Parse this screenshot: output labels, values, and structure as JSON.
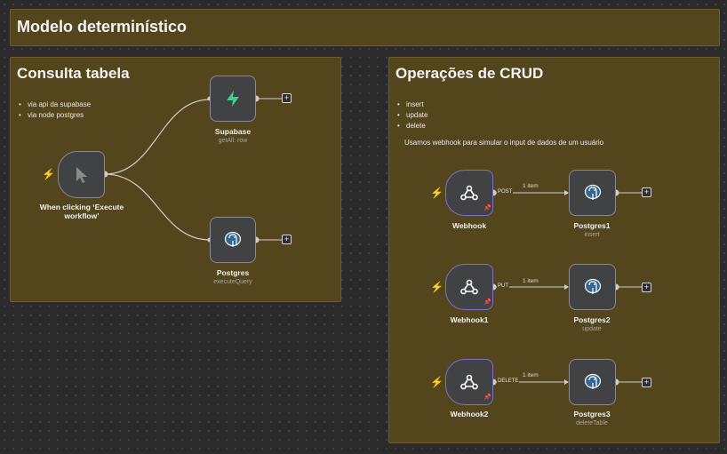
{
  "notes": {
    "main": {
      "title": "Modelo determinístico"
    },
    "query": {
      "title": "Consulta tabela",
      "bullets": [
        "via api da supabase",
        "via node postgres"
      ]
    },
    "crud": {
      "title": "Operações de CRUD",
      "bullets": [
        "insert",
        "update",
        "delete"
      ],
      "text": "Usamos webhook para simular o input de dados de um usuário"
    }
  },
  "nodes": {
    "manual_trigger": {
      "label_line1": "When clicking ‘Execute",
      "label_line2": "workflow’",
      "icon": "cursor-icon"
    },
    "supabase": {
      "label": "Supabase",
      "sub": "getAll: row",
      "icon": "supabase-icon"
    },
    "postgres": {
      "label": "Postgres",
      "sub": "executeQuery",
      "icon": "postgres-icon"
    },
    "webhook": {
      "label": "Webhook",
      "method": "POST",
      "icon": "webhook-icon"
    },
    "webhook1": {
      "label": "Webhook1",
      "method": "PUT",
      "icon": "webhook-icon"
    },
    "webhook2": {
      "label": "Webhook2",
      "method": "DELETE",
      "icon": "webhook-icon"
    },
    "postgres1": {
      "label": "Postgres1",
      "sub": "insert",
      "icon": "postgres-icon"
    },
    "postgres2": {
      "label": "Postgres2",
      "sub": "update",
      "icon": "postgres-icon"
    },
    "postgres3": {
      "label": "Postgres3",
      "sub": "deleteTable",
      "icon": "postgres-icon"
    }
  },
  "edges": {
    "item_count": "1 item"
  },
  "ui": {
    "add_symbol": "+",
    "trigger_symbol": "⚡",
    "pin_symbol": "📌"
  },
  "colors": {
    "canvas": "#2b2b2b",
    "sticky": "#54461c",
    "node": "#414244",
    "trigger": "#ff6d5a",
    "webhook_border": "#7d70c7",
    "supabase": "#3ecf8e",
    "postgres": "#336791"
  }
}
